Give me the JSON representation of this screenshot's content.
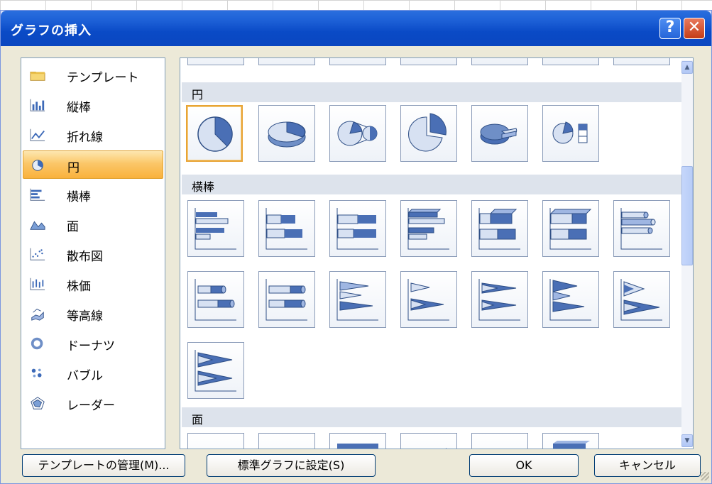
{
  "window": {
    "title": "グラフの挿入",
    "help_glyph": "?",
    "close_glyph": "✕"
  },
  "categories": [
    {
      "label": "テンプレート",
      "icon": "folder-icon"
    },
    {
      "label": "縦棒",
      "icon": "column-chart-icon"
    },
    {
      "label": "折れ線",
      "icon": "line-chart-icon"
    },
    {
      "label": "円",
      "icon": "pie-chart-icon"
    },
    {
      "label": "横棒",
      "icon": "bar-chart-icon"
    },
    {
      "label": "面",
      "icon": "area-chart-icon"
    },
    {
      "label": "散布図",
      "icon": "scatter-chart-icon"
    },
    {
      "label": "株価",
      "icon": "stock-chart-icon"
    },
    {
      "label": "等高線",
      "icon": "surface-chart-icon"
    },
    {
      "label": "ドーナツ",
      "icon": "doughnut-chart-icon"
    },
    {
      "label": "バブル",
      "icon": "bubble-chart-icon"
    },
    {
      "label": "レーダー",
      "icon": "radar-chart-icon"
    }
  ],
  "selected_category": "円",
  "gallery": {
    "sections": [
      {
        "label": "円",
        "tile_count": 6
      },
      {
        "label": "横棒",
        "tile_count": 15
      },
      {
        "label": "面",
        "tile_count": 6
      }
    ],
    "selected_tile": "円-1"
  },
  "buttons": {
    "manage_templates": "テンプレートの管理(M)...",
    "set_default": "標準グラフに設定(S)",
    "ok": "OK",
    "cancel": "キャンセル"
  },
  "colors": {
    "accent": "#4a6fb5",
    "title_bar": "#0b4cc4",
    "selection": "#f9b13c"
  }
}
